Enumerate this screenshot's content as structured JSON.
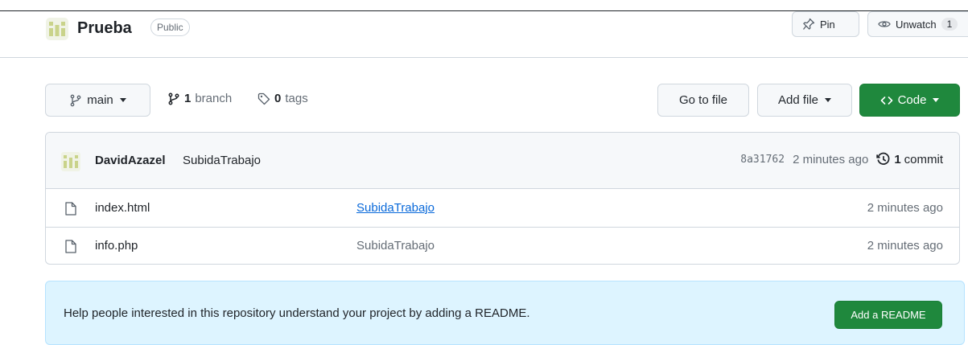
{
  "repo": {
    "name": "Prueba",
    "visibility": "Public",
    "pin_label": "Pin",
    "watch_label": "Unwatch",
    "watch_count": "1"
  },
  "toolbar": {
    "branch_name": "main",
    "branch_count": "1",
    "branch_label": "branch",
    "tag_count": "0",
    "tag_label": "tags",
    "goto_file": "Go to file",
    "add_file": "Add file",
    "code": "Code"
  },
  "latest_commit": {
    "author": "DavidAzazel",
    "message": "SubidaTrabajo",
    "sha": "8a31762",
    "time": "2 minutes ago",
    "commit_count": "1",
    "commit_label": "commit"
  },
  "files": [
    {
      "name": "index.html",
      "message": "SubidaTrabajo",
      "date": "2 minutes ago"
    },
    {
      "name": "info.php",
      "message": "SubidaTrabajo",
      "date": "2 minutes ago"
    }
  ],
  "readme_banner": {
    "text": "Help people interested in this repository understand your project by adding a README.",
    "button": "Add a README"
  },
  "colors": {
    "accent_green": "#1f883d",
    "link_blue": "#0969da",
    "banner_bg": "#ddf4ff"
  },
  "icons": [
    "repo-identicon",
    "pin-icon",
    "eye-icon",
    "git-branch-icon",
    "tag-icon",
    "code-icon",
    "history-icon",
    "file-icon"
  ]
}
